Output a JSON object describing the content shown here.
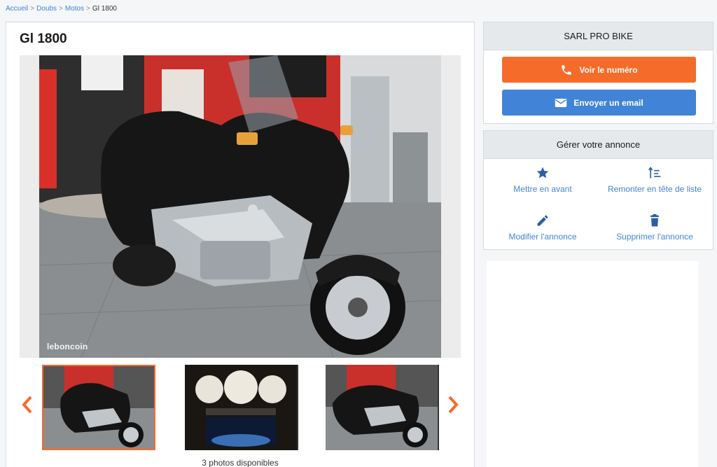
{
  "breadcrumb": {
    "items": [
      "Accueil",
      "Doubs",
      "Motos"
    ],
    "separator": ">",
    "current": "Gl 1800"
  },
  "ad": {
    "title": "Gl 1800",
    "watermark": "leboncoin",
    "photo_count_label": "3 photos disponibles",
    "thumbnails": [
      "photo-1",
      "photo-2",
      "photo-3"
    ],
    "active_thumbnail": 0
  },
  "seller": {
    "name": "SARL PRO BIKE",
    "phone_button": "Voir le numéro",
    "email_button": "Envoyer un email",
    "phone_icon": "phone-icon",
    "email_icon": "envelope-icon"
  },
  "manage": {
    "title": "Gérer votre annonce",
    "actions": [
      {
        "label": "Mettre en avant",
        "icon": "star-icon"
      },
      {
        "label": "Remonter en tête de liste",
        "icon": "sort-up-icon"
      },
      {
        "label": "Modifier l'annonce",
        "icon": "pencil-icon"
      },
      {
        "label": "Supprimer l'annonce",
        "icon": "trash-icon"
      }
    ]
  },
  "colors": {
    "accent_orange": "#f56b2a",
    "accent_blue": "#4183d7",
    "panel_header": "#e6e9eb",
    "page_bg": "#f4f6f7"
  }
}
